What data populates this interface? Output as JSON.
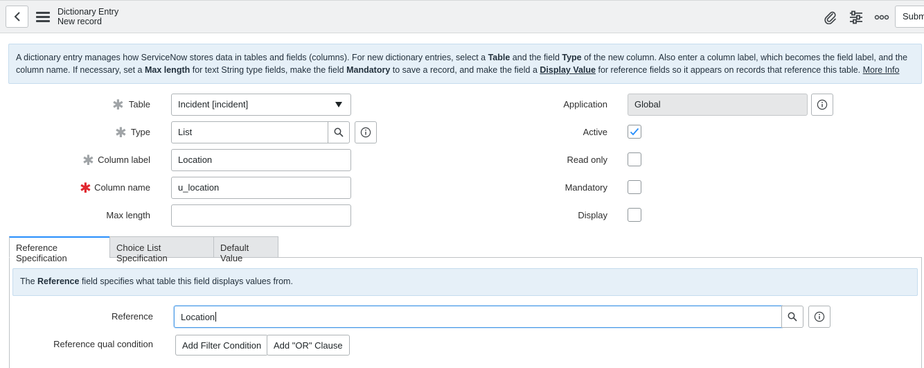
{
  "header": {
    "title": "Dictionary Entry",
    "subtitle": "New record",
    "submit_label": "Subm"
  },
  "info_box": {
    "p1": "A dictionary entry manages how ServiceNow stores data in tables and fields (columns). For new dictionary entries, select a ",
    "b1": "Table",
    "p2": " and the field ",
    "b2": "Type",
    "p3": " of the new column. Also enter a column label, which becomes the field label, and the column name. If necessary, set a ",
    "b3": "Max length",
    "p4": " for text String type fields, make the field ",
    "b4": "Mandatory",
    "p5": " to save a record, and make the field a ",
    "u1": "Display Value",
    "p6": " for reference fields so it appears on records that reference this table. ",
    "link": "More Info"
  },
  "form": {
    "table": {
      "label": "Table",
      "value": "Incident [incident]"
    },
    "type": {
      "label": "Type",
      "value": "List"
    },
    "column_label": {
      "label": "Column label",
      "value": "Location"
    },
    "column_name": {
      "label": "Column name",
      "value": "u_location"
    },
    "max_length": {
      "label": "Max length",
      "value": ""
    },
    "application": {
      "label": "Application",
      "value": "Global"
    },
    "active": {
      "label": "Active",
      "checked": true
    },
    "read_only": {
      "label": "Read only",
      "checked": false
    },
    "mandatory": {
      "label": "Mandatory",
      "checked": false
    },
    "display": {
      "label": "Display",
      "checked": false
    }
  },
  "tabs": [
    {
      "label": "Reference Specification",
      "active": true
    },
    {
      "label": "Choice List Specification",
      "active": false
    },
    {
      "label": "Default Value",
      "active": false
    }
  ],
  "reference_tab": {
    "info_pre": "The ",
    "info_bold": "Reference",
    "info_post": " field specifies what table this field displays values from.",
    "reference_label": "Reference",
    "reference_value": "Location",
    "qual_label": "Reference qual condition",
    "add_filter_label": "Add Filter Condition",
    "add_or_label": "Add \"OR\" Clause"
  },
  "colors": {
    "accent": "#278efc",
    "info_bg": "#e6f0f8",
    "mandatory_star": "#e0272f"
  }
}
